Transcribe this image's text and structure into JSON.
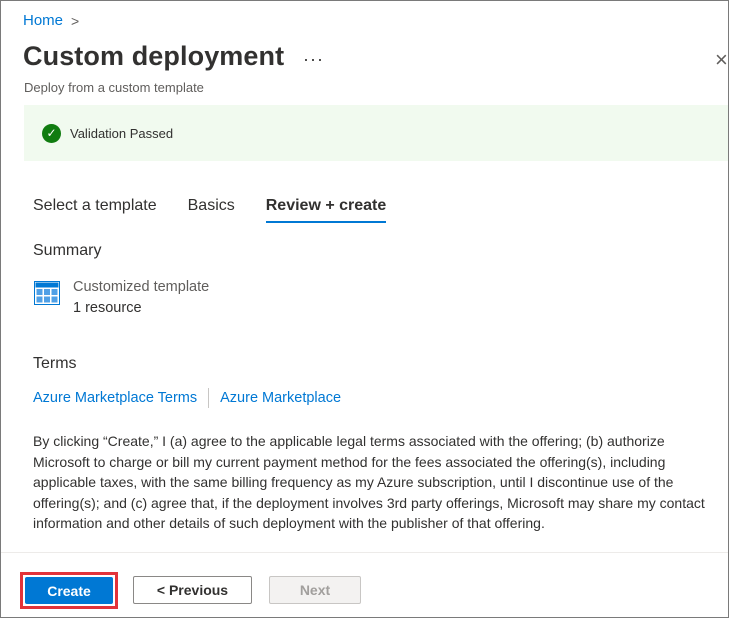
{
  "breadcrumb": {
    "home": "Home",
    "separator": ">"
  },
  "header": {
    "title": "Custom deployment",
    "more": "···",
    "close": "×",
    "subtitle": "Deploy from a custom template"
  },
  "banner": {
    "icon": "checkmark-circle-icon",
    "color": "#107c10",
    "text": "Validation Passed"
  },
  "tabs": [
    {
      "label": "Select a template"
    },
    {
      "label": "Basics"
    },
    {
      "label": "Review + create",
      "active": true
    }
  ],
  "summary": {
    "heading": "Summary",
    "icon": "template-icon",
    "template_name": "Customized template",
    "resource_count": "1 resource"
  },
  "terms": {
    "heading": "Terms",
    "link1": "Azure Marketplace Terms",
    "link2": "Azure Marketplace",
    "text": "By clicking “Create,” I (a) agree to the applicable legal terms associated with the offering; (b) authorize Microsoft to charge or bill my current payment method for the fees associated the offering(s), including applicable taxes, with the same billing frequency as my Azure subscription, until I discontinue use of the offering(s); and (c) agree that, if the deployment involves 3rd party offerings, Microsoft may share my contact information and other details of such deployment with the publisher of that offering."
  },
  "footer": {
    "create_label": "Create",
    "previous_label": "< Previous",
    "next_label": "Next"
  },
  "colors": {
    "accent": "#0078d4",
    "highlight_outline": "#e2333a",
    "success_bg": "#f1faef"
  }
}
